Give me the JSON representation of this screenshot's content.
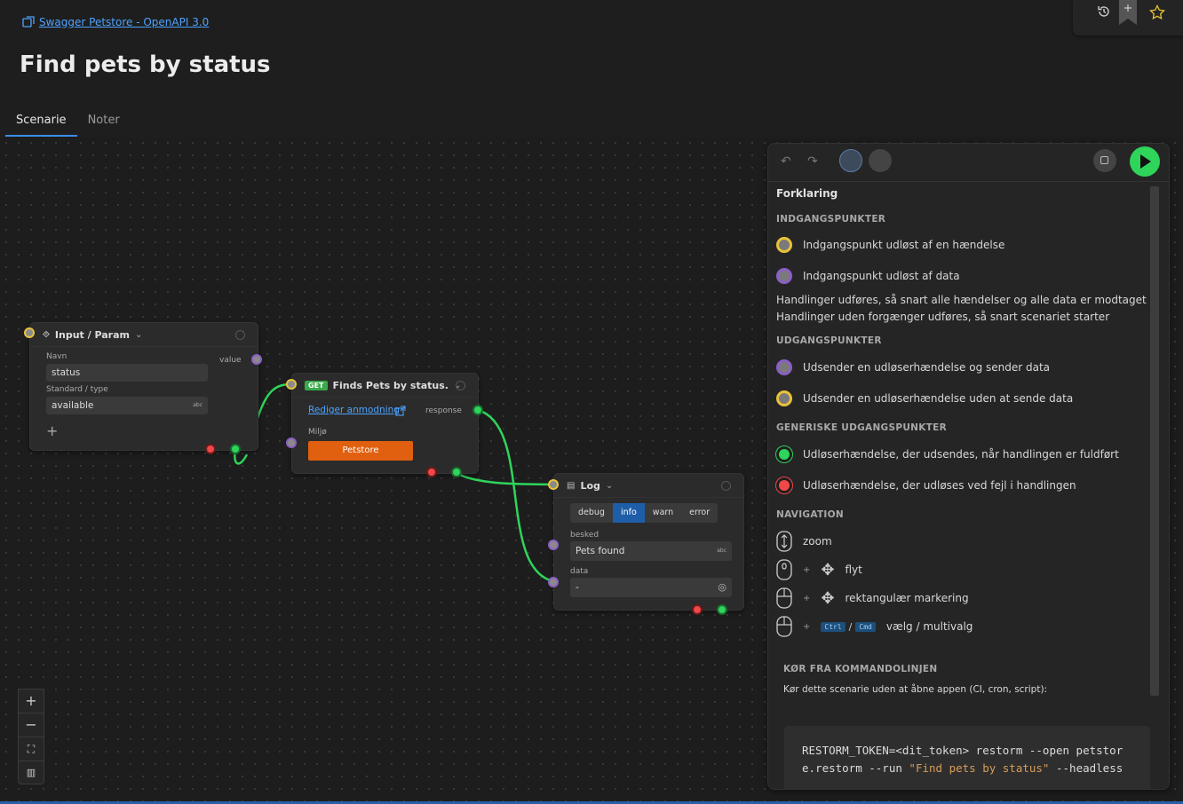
{
  "header": {
    "breadcrumb": "Swagger Petstore - OpenAPI 3.0",
    "title": "Find pets by status",
    "tabs": [
      {
        "label": "Scenarie",
        "active": true
      },
      {
        "label": "Noter",
        "active": false
      }
    ]
  },
  "nodes": {
    "input": {
      "title": "Input / Param",
      "name_label": "Navn",
      "name_value": "status",
      "default_label": "Standard / type",
      "default_value": "available",
      "type_badge": "abc",
      "value_label": "value"
    },
    "request": {
      "method": "GET",
      "title": "Finds Pets by status.",
      "edit_link": "Rediger anmodning",
      "response_label": "response",
      "env_label": "Miljø",
      "env_button": "Petstore"
    },
    "log": {
      "title": "Log",
      "levels": [
        "debug",
        "info",
        "warn",
        "error"
      ],
      "active_level": "info",
      "message_label": "besked",
      "message_value": "Pets found",
      "message_badge": "abc",
      "data_label": "data",
      "data_value": "-"
    }
  },
  "legend": {
    "heading": "Forklaring",
    "entry_section": "INDGANGSPUNKTER",
    "entry_event": "Indgangspunkt udløst af en hændelse",
    "entry_data": "Indgangspunkt udløst af data",
    "note1": "Handlinger udføres, så snart alle hændelser og alle data er modtaget",
    "note2": "Handlinger uden forgænger udføres, så snart scenariet starter",
    "exit_section": "UDGANGSPUNKTER",
    "exit_data": "Udsender en udløserhændelse og sender data",
    "exit_nodata": "Udsender en udløserhændelse uden at sende data",
    "generic_section": "GENERISKE UDGANGSPUNKTER",
    "generic_done": "Udløserhændelse, der udsendes, når handlingen er fuldført",
    "generic_error": "Udløserhændelse, der udløses ved fejl i handlingen",
    "nav_section": "NAVIGATION",
    "nav_zoom": "zoom",
    "nav_move": "flyt",
    "nav_rect": "rektangulær markering",
    "nav_select": "vælg / multivalg",
    "plus": "+",
    "key_ctrl": "Ctrl",
    "key_sep": "/",
    "key_cmd": "Cmd",
    "cli_section": "KØR FRA KOMMANDOLINJEN",
    "cli_desc": "Kør dette scenarie uden at åbne appen (CI, cron, script):",
    "cli_cmd_a": "RESTORM_TOKEN=<dit_token> restorm --open petstore.restorm --run ",
    "cli_cmd_str": "\"Find pets by status\"",
    "cli_cmd_b": " --headless"
  },
  "zoom_controls": {
    "plus": "+",
    "minus": "−"
  },
  "colors": {
    "accent": "#3b8ee8",
    "event_port": "#e8c23a",
    "data_port": "#8b5fc6",
    "success": "#2fd45a",
    "error": "#f04848",
    "env_button": "#e06010",
    "get_badge": "#3aa84a"
  },
  "icons": {
    "breadcrumb": "api-icon",
    "history": "history-icon",
    "bookmark": "bookmark-icon",
    "favorite": "star-icon",
    "undo": "undo-icon",
    "redo": "redo-icon",
    "stop": "stop-icon",
    "run": "play-icon"
  }
}
